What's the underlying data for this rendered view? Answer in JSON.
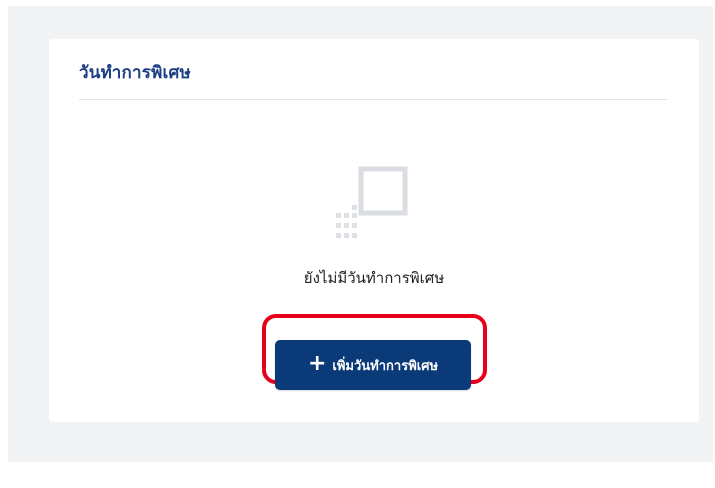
{
  "card": {
    "title": "วันทำการพิเศษ"
  },
  "empty_state": {
    "icon": "empty-box-icon",
    "message": "ยังไม่มีวันทำการพิเศษ"
  },
  "add_button": {
    "icon": "plus-icon",
    "symbol": "+",
    "label": "เพิ่มวันทำการพิเศษ"
  },
  "colors": {
    "title": "#1c3f85",
    "button_background": "#0b3a78",
    "highlight": "#e60019",
    "canvas_background": "#f2f3f5"
  }
}
